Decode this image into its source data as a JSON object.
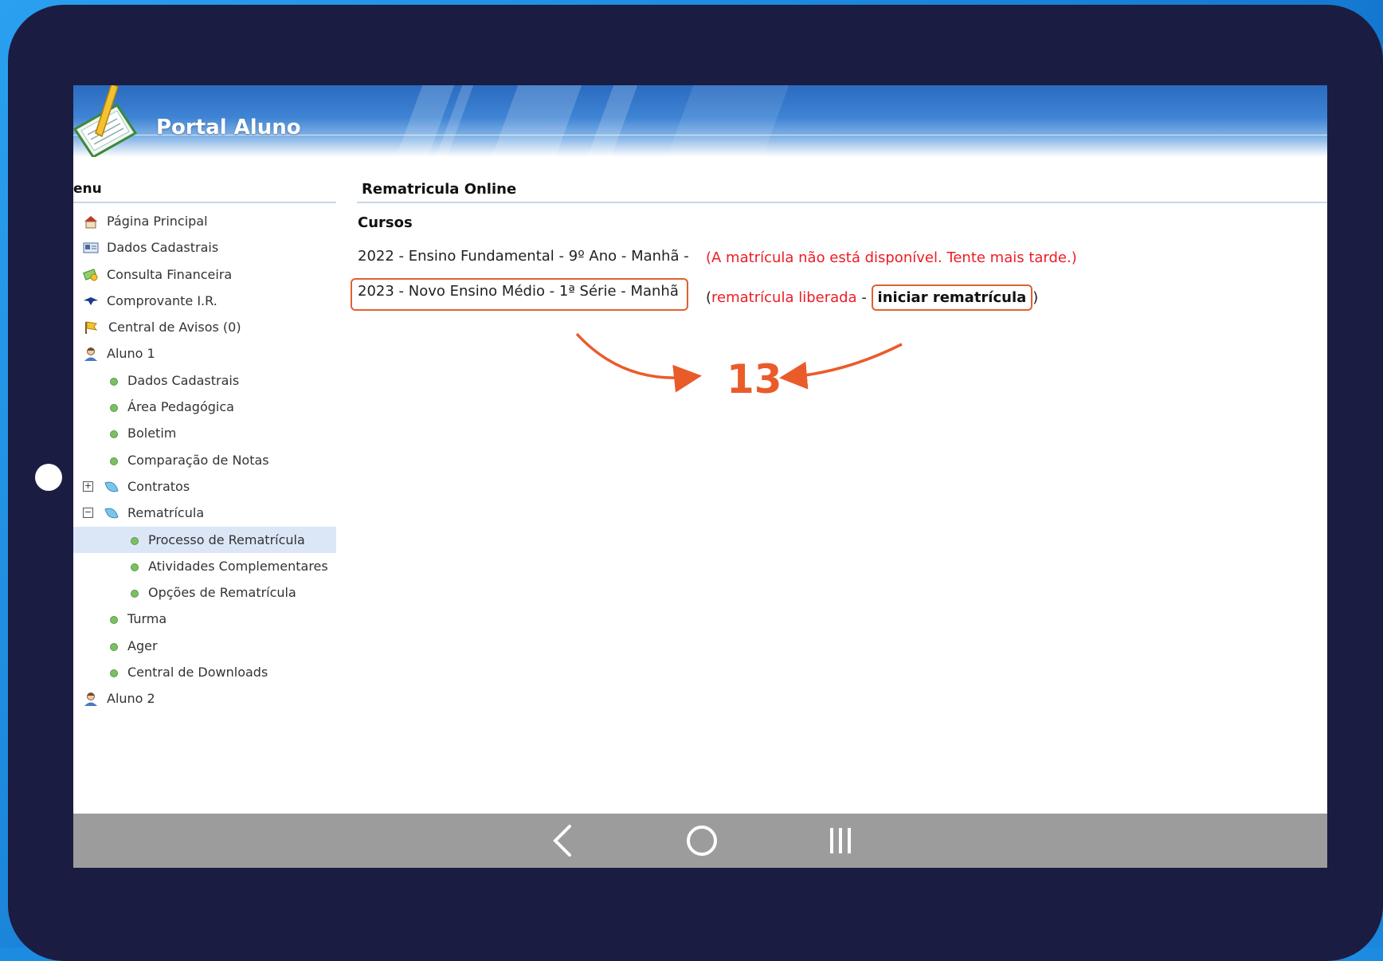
{
  "header": {
    "title": "Portal Aluno"
  },
  "sidebar": {
    "menu_title": "enu",
    "items": [
      {
        "label": "Página Principal",
        "icon": "house-icon"
      },
      {
        "label": "Dados Cadastrais",
        "icon": "id-card-icon"
      },
      {
        "label": "Consulta Financeira",
        "icon": "money-icon"
      },
      {
        "label": "Comprovante I.R.",
        "icon": "eagle-icon"
      },
      {
        "label": "Central de Avisos (0)",
        "icon": "flag-icon"
      },
      {
        "label": "Aluno 1",
        "icon": "student-icon"
      },
      {
        "label": "Dados Cadastrais"
      },
      {
        "label": "Área Pedagógica"
      },
      {
        "label": "Boletim"
      },
      {
        "label": "Comparação de Notas"
      },
      {
        "label": "Contratos",
        "toggle": "+"
      },
      {
        "label": "Rematrícula",
        "toggle": "−"
      },
      {
        "label": "Processo de Rematrícula",
        "active": true
      },
      {
        "label": "Atividades Complementares"
      },
      {
        "label": "Opções de Rematrícula"
      },
      {
        "label": "Turma"
      },
      {
        "label": "Ager"
      },
      {
        "label": "Central de Downloads"
      },
      {
        "label": "Aluno 2",
        "icon": "student-icon"
      }
    ]
  },
  "main": {
    "title": "Rematricula Online",
    "section": "Cursos",
    "courses": [
      {
        "name": "2022 - Ensino Fundamental - 9º Ano - Manhã -",
        "status": "(A matrícula não está disponível. Tente mais tarde.)"
      },
      {
        "name": "2023 - Novo Ensino Médio - 1ª Série - Manhã",
        "status_open": "(",
        "status_text": "rematrícula liberada",
        "status_sep": " - ",
        "action": "iniciar rematrícula",
        "status_close": ")"
      }
    ]
  },
  "annotation": {
    "step": "13",
    "color": "#ea5b2a"
  },
  "colors": {
    "accent_red": "#ee1c24",
    "highlight": "#e06030",
    "header_blue": "#2a6bc0",
    "tablet_frame": "#1b1c42"
  }
}
